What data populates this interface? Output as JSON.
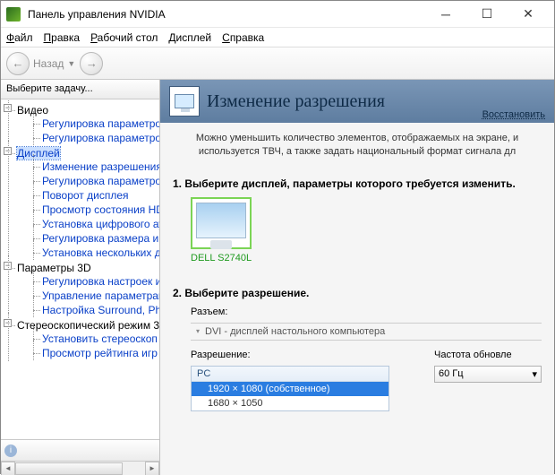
{
  "window": {
    "title": "Панель управления NVIDIA"
  },
  "menu": {
    "file": "Файл",
    "edit": "Правка",
    "desktop": "Рабочий стол",
    "display": "Дисплей",
    "help": "Справка"
  },
  "toolbar": {
    "back": "←",
    "back_label": "Назад",
    "fwd": "→"
  },
  "sidebar": {
    "heading": "Выберите задачу...",
    "tree": {
      "video": {
        "label": "Видео",
        "items": [
          "Регулировка параметров",
          "Регулировка параметров"
        ]
      },
      "display": {
        "label": "Дисплей",
        "items": [
          "Изменение разрешения",
          "Регулировка параметров",
          "Поворот дисплея",
          "Просмотр состояния HDC",
          "Установка цифрового ау",
          "Регулировка размера и п",
          "Установка нескольких д"
        ]
      },
      "params3d": {
        "label": "Параметры 3D",
        "items": [
          "Регулировка настроек и",
          "Управление параметрам",
          "Настройка Surround, Phy"
        ]
      },
      "stereo": {
        "label": "Стереоскопический режим 3",
        "items": [
          "Установить стереоскоп",
          "Просмотр рейтинга игр"
        ]
      }
    },
    "selected": "Дисплей"
  },
  "content": {
    "title": "Изменение разрешения",
    "restore": "Восстановить",
    "intro": "Можно уменьшить количество элементов, отображаемых на экране, и используется ТВЧ, а также задать национальный формат сигнала дл",
    "step1": "1. Выберите дисплей, параметры которого требуется изменить.",
    "monitor_name": "DELL S2740L",
    "step2": "2. Выберите разрешение.",
    "connector_label": "Разъем:",
    "connector_value": "DVI - дисплей настольного компьютера",
    "resolution_label": "Разрешение:",
    "refresh_label": "Частота обновле",
    "res_group": "PC",
    "res_options": [
      "1920 × 1080 (собственное)",
      "1680 × 1050"
    ],
    "refresh_value": "60 Гц"
  }
}
